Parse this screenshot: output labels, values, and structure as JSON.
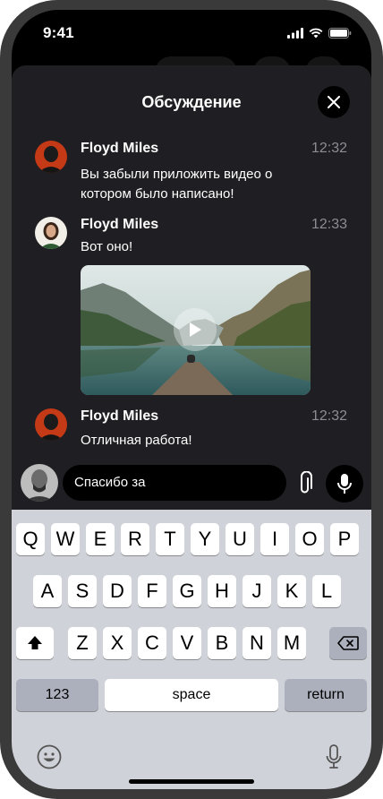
{
  "status_bar": {
    "time": "9:41"
  },
  "sheet": {
    "title": "Обсуждение"
  },
  "messages": [
    {
      "name": "Floyd Miles",
      "time": "12:32",
      "text": "Вы забыли приложить видео о котором было написано!"
    },
    {
      "name": "Floyd Miles",
      "time": "12:33",
      "text": "Вот оно!"
    },
    {
      "name": "Floyd Miles",
      "time": "12:32",
      "text": "Отличная работа!"
    }
  ],
  "composer": {
    "value": "Спасибо за"
  },
  "keyboard": {
    "row1": [
      "Q",
      "W",
      "E",
      "R",
      "T",
      "Y",
      "U",
      "I",
      "O",
      "P"
    ],
    "row2": [
      "A",
      "S",
      "D",
      "F",
      "G",
      "H",
      "J",
      "K",
      "L"
    ],
    "row3": [
      "Z",
      "X",
      "C",
      "V",
      "B",
      "N",
      "M"
    ],
    "numbers_label": "123",
    "space_label": "space",
    "return_label": "return"
  },
  "colors": {
    "sheet_bg": "#1f1e22",
    "keyboard_bg": "#cfd2d8",
    "time_gray": "#8e8d93"
  },
  "icons": [
    "close-icon",
    "play-icon",
    "paperclip-icon",
    "microphone-icon",
    "shift-icon",
    "backspace-icon",
    "emoji-icon",
    "dictation-icon"
  ]
}
